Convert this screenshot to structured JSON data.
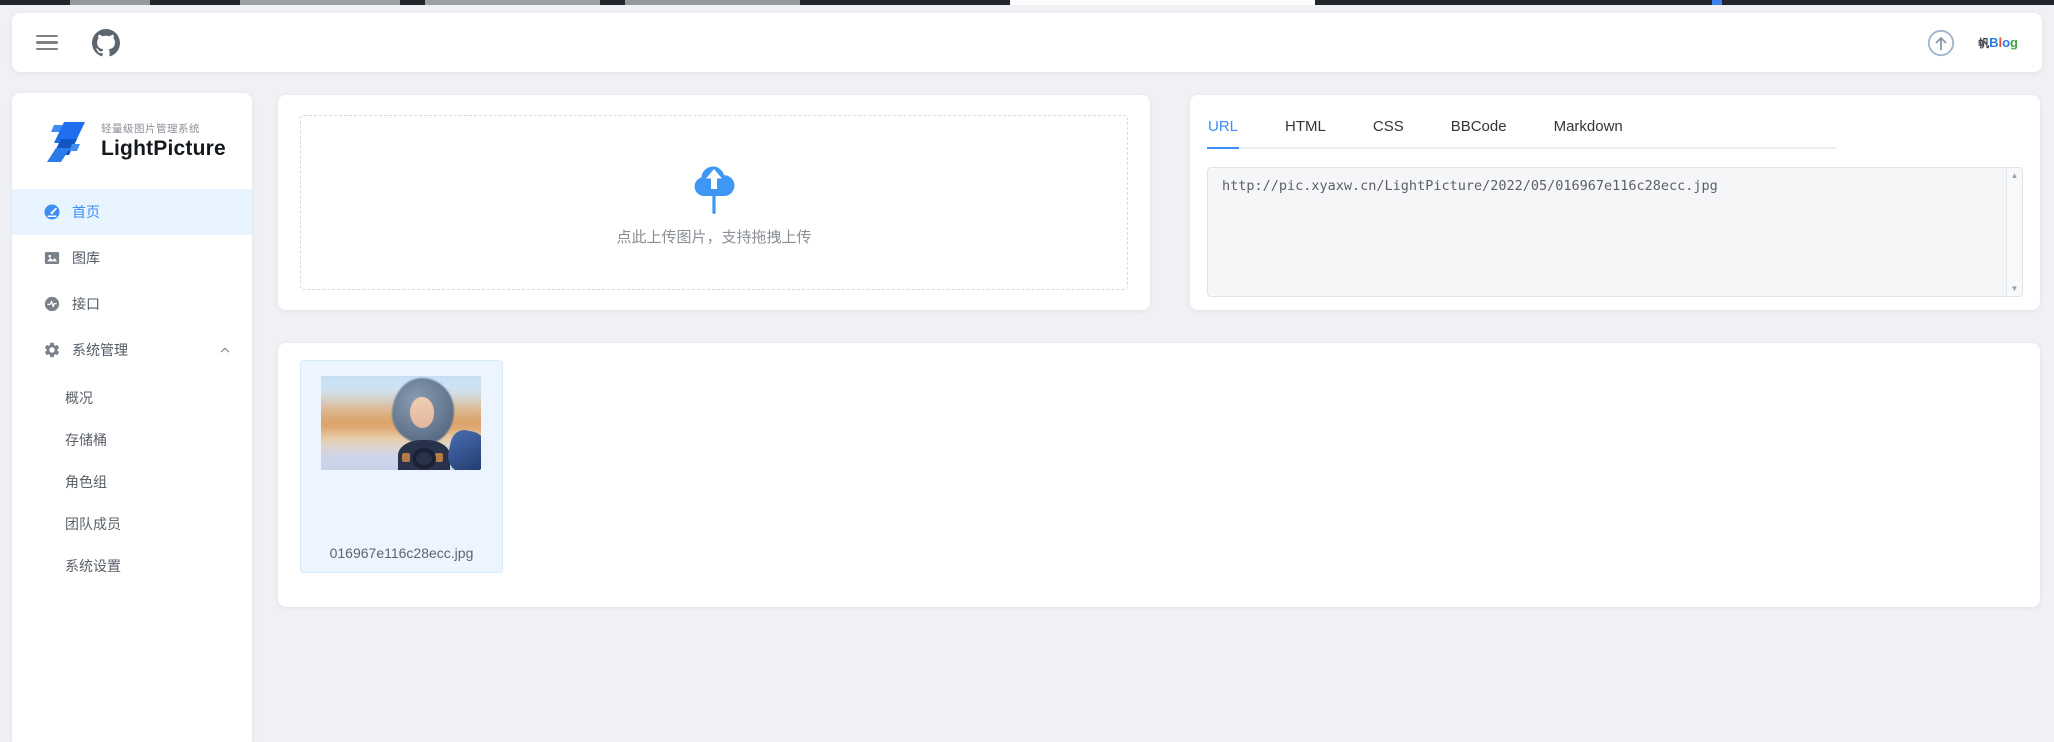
{
  "colors": {
    "accent": "#3e8ef5",
    "sidebar_active_bg": "#e8f4ff",
    "image_card_bg": "#ecf5ff",
    "page_bg": "#eff1f5"
  },
  "topbar": {
    "icons": {
      "menu": "hamburger-icon",
      "github": "github-icon",
      "scroll_top": "circle-arrow-up-icon",
      "avatar": "avatar-logo"
    },
    "avatar_letters": [
      "帆",
      "B",
      "l",
      "o",
      "g"
    ]
  },
  "sidebar": {
    "logo_subtitle": "轻量级图片管理系统",
    "logo_title": "LightPicture",
    "items": [
      {
        "label": "首页",
        "icon": "dashboard-icon",
        "active": true
      },
      {
        "label": "图库",
        "icon": "gallery-icon",
        "active": false
      },
      {
        "label": "接口",
        "icon": "api-icon",
        "active": false
      },
      {
        "label": "系统管理",
        "icon": "gear-icon",
        "active": false,
        "expanded": true
      }
    ],
    "submenu": [
      {
        "label": "概况"
      },
      {
        "label": "存储桶"
      },
      {
        "label": "角色组"
      },
      {
        "label": "团队成员"
      },
      {
        "label": "系统设置"
      }
    ]
  },
  "upload": {
    "icon": "cloud-upload-icon",
    "hint": "点此上传图片，支持拖拽上传"
  },
  "link_panel": {
    "tabs": [
      {
        "label": "URL",
        "active": true
      },
      {
        "label": "HTML",
        "active": false
      },
      {
        "label": "CSS",
        "active": false
      },
      {
        "label": "BBCode",
        "active": false
      },
      {
        "label": "Markdown",
        "active": false
      }
    ],
    "url_value": "http://pic.xyaxw.cn/LightPicture/2022/05/016967e116c28ecc.jpg",
    "scrollbar": {
      "up_glyph": "▲",
      "down_glyph": "▼"
    }
  },
  "gallery": {
    "items": [
      {
        "filename": "016967e116c28ecc.jpg"
      }
    ]
  }
}
